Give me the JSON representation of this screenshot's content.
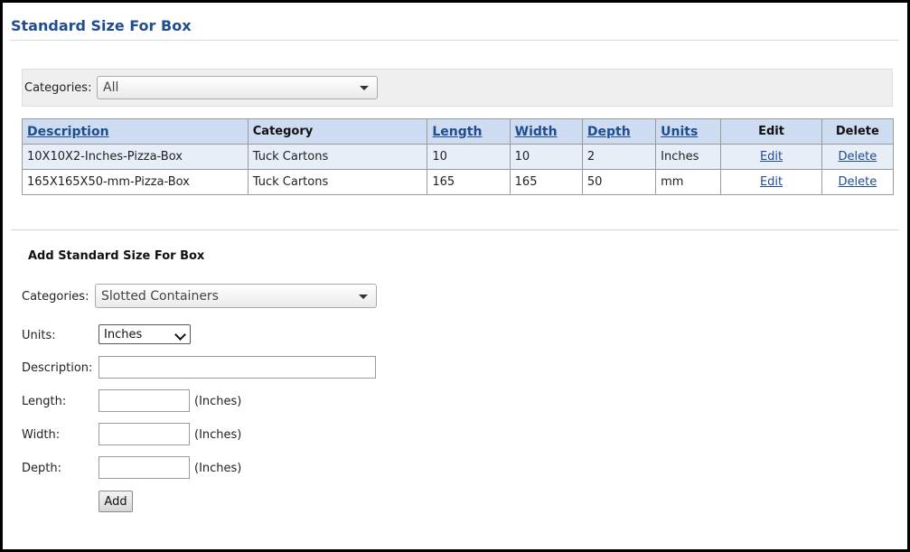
{
  "page": {
    "title": "Standard Size For Box"
  },
  "filter": {
    "label": "Categories:",
    "selected": "All"
  },
  "table": {
    "columns": [
      {
        "label": "Description",
        "link": true
      },
      {
        "label": "Category",
        "link": false
      },
      {
        "label": "Length",
        "link": true
      },
      {
        "label": "Width",
        "link": true
      },
      {
        "label": "Depth",
        "link": true
      },
      {
        "label": "Units",
        "link": true
      },
      {
        "label": "Edit",
        "link": false
      },
      {
        "label": "Delete",
        "link": false
      }
    ],
    "rows": [
      {
        "description": "10X10X2-Inches-Pizza-Box",
        "category": "Tuck Cartons",
        "length": "10",
        "width": "10",
        "depth": "2",
        "units": "Inches",
        "edit": "Edit",
        "delete": "Delete"
      },
      {
        "description": "165X165X50-mm-Pizza-Box",
        "category": "Tuck Cartons",
        "length": "165",
        "width": "165",
        "depth": "50",
        "units": "mm",
        "edit": "Edit",
        "delete": "Delete"
      }
    ]
  },
  "add_form": {
    "title": "Add Standard Size For Box",
    "categories_label": "Categories:",
    "categories_selected": "Slotted Containers",
    "units_label": "Units:",
    "units_selected": "Inches",
    "description_label": "Description:",
    "description_value": "",
    "length_label": "Length:",
    "length_value": "",
    "length_unit": "(Inches)",
    "width_label": "Width:",
    "width_value": "",
    "width_unit": "(Inches)",
    "depth_label": "Depth:",
    "depth_value": "",
    "depth_unit": "(Inches)",
    "add_button": "Add"
  },
  "colors": {
    "title": "#1f4d8f",
    "header_bg": "#cddcf0",
    "row_alt": "#e7eef8",
    "link": "#1f4d8f"
  }
}
